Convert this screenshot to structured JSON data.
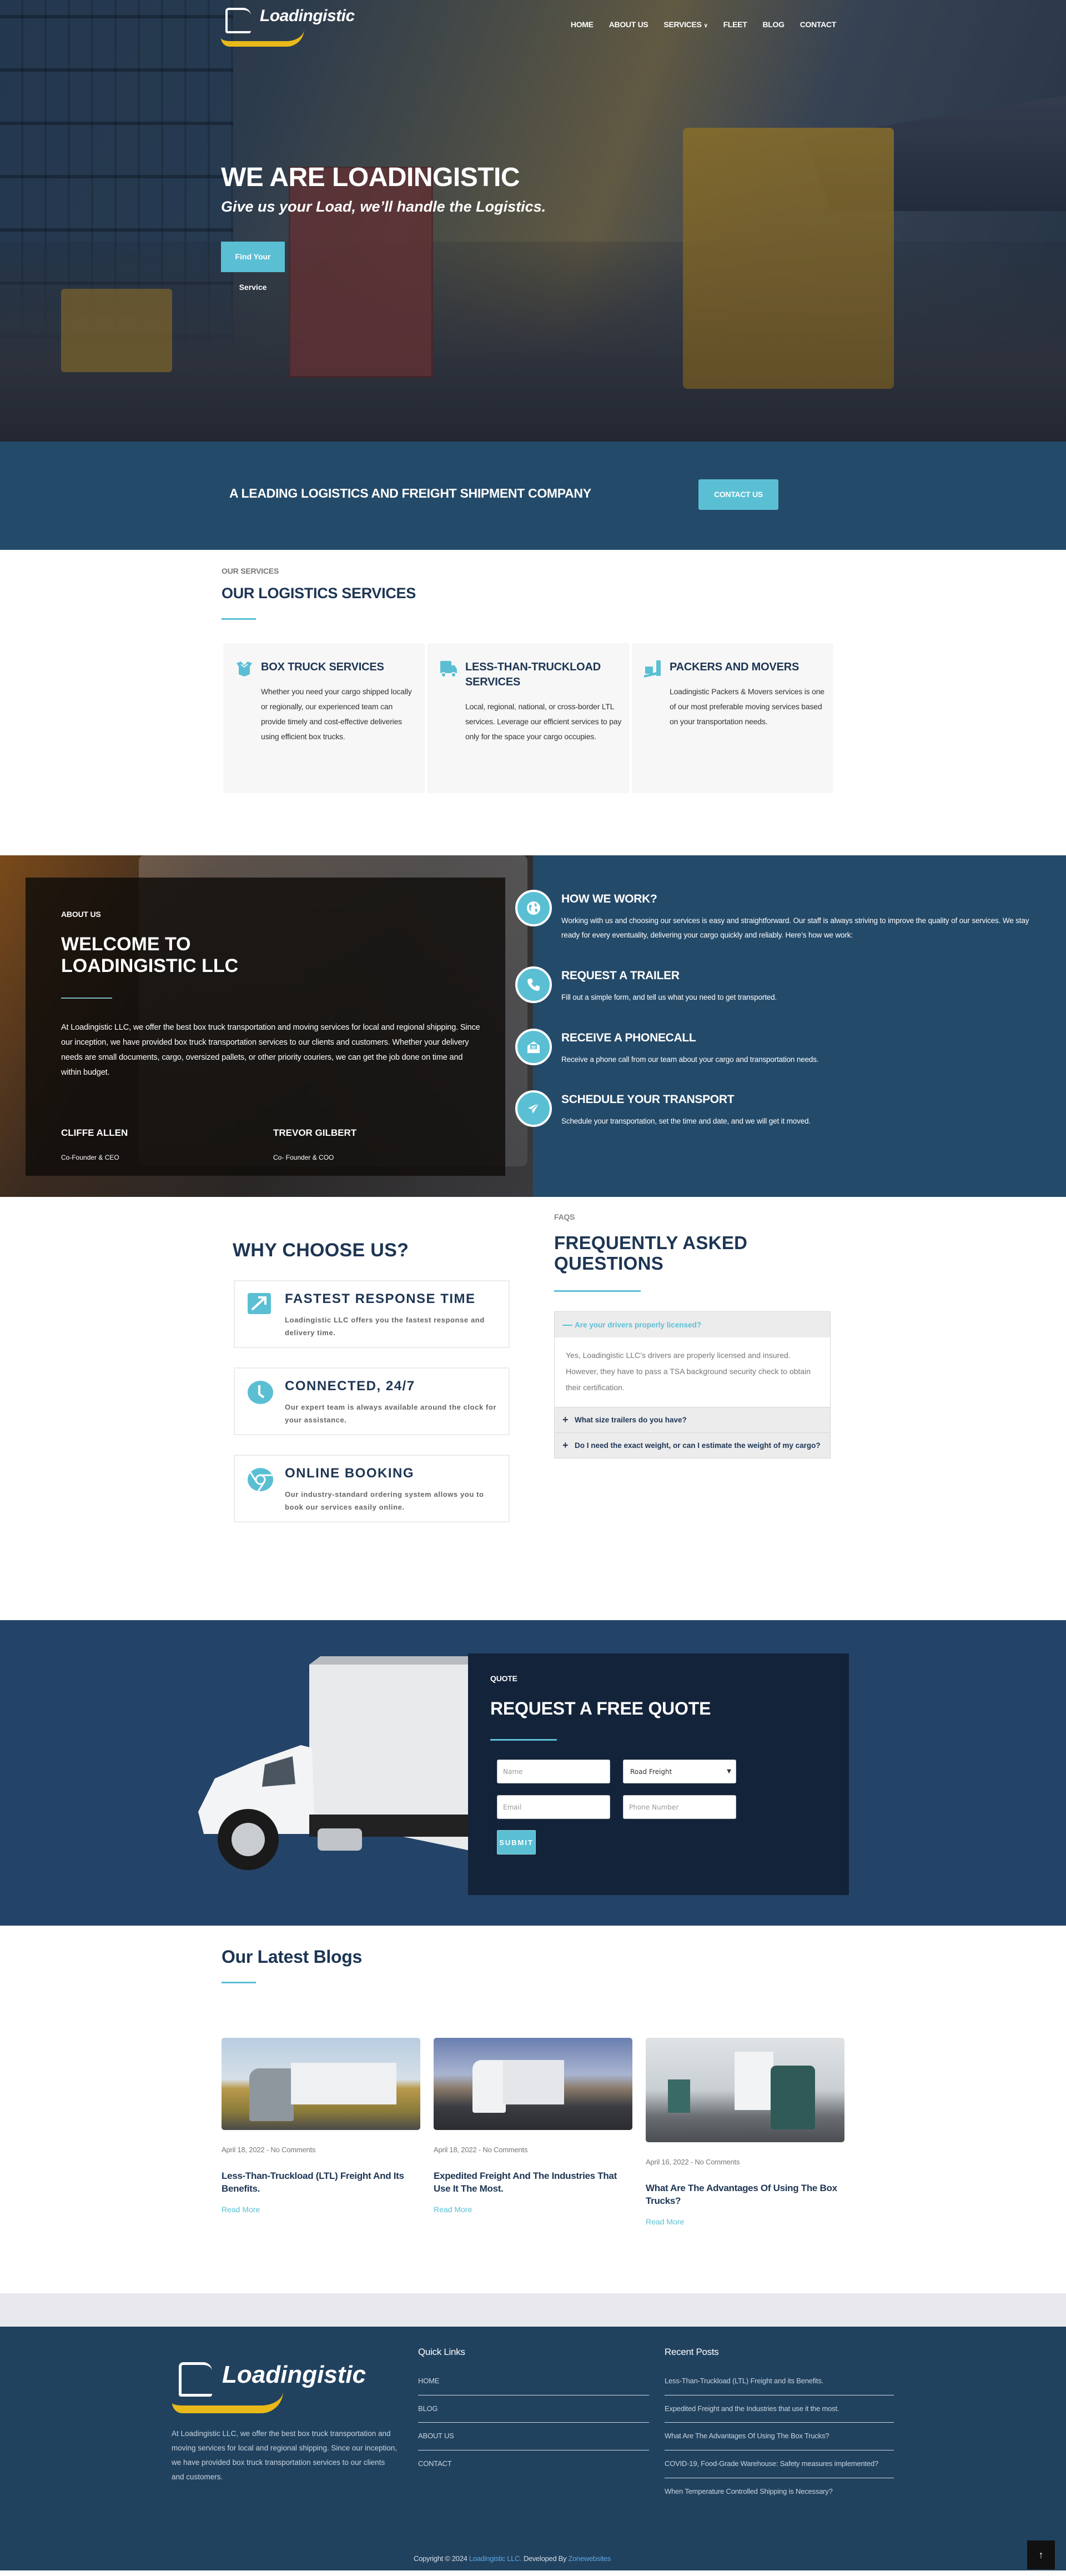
{
  "brand": {
    "name": "Loadingistic",
    "accent": "#5bbfd4",
    "navy": "#1d3553",
    "band": "#244a69",
    "logo_yellow": "#e9b91a"
  },
  "nav": {
    "items": [
      {
        "label": "HOME"
      },
      {
        "label": "ABOUT US"
      },
      {
        "label": "SERVICES",
        "has_dropdown": true
      },
      {
        "label": "FLEET"
      },
      {
        "label": "BLOG"
      },
      {
        "label": "CONTACT"
      }
    ]
  },
  "hero": {
    "title": "WE ARE LOADINGISTIC",
    "tagline": "Give us your Load, we’ll handle the Logistics.",
    "cta_label": "Find Your Service"
  },
  "cta_band": {
    "text": "A LEADING LOGISTICS AND FREIGHT SHIPMENT COMPANY",
    "button_label": "CONTACT US"
  },
  "services": {
    "eyebrow": "OUR SERVICES",
    "title": "OUR LOGISTICS SERVICES",
    "items": [
      {
        "icon": "open-box-icon",
        "title": "BOX TRUCK SERVICES",
        "text": "Whether you need your cargo shipped locally or regionally, our experienced team can provide timely and cost-effective deliveries using efficient box trucks."
      },
      {
        "icon": "truck-icon",
        "title": "LESS-THAN-TRUCKLOAD SERVICES",
        "text": "Local, regional, national, or cross-border LTL services. Leverage our efficient services to pay only for the space your cargo occupies."
      },
      {
        "icon": "dolly-box-icon",
        "title": "PACKERS AND MOVERS",
        "text": "Loadingistic Packers & Movers services is one of our most preferable moving services based on your transportation needs."
      }
    ]
  },
  "about": {
    "eyebrow": "ABOUT US",
    "title": "WELCOME TO LOADINGISTIC LLC",
    "text": "At Loadingistic LLC, we offer the best box truck transportation and moving services for local and regional shipping. Since our inception, we have provided box truck transportation services to our clients and customers. Whether your delivery needs are small documents, cargo, oversized pallets, or other priority couriers, we can get the job done on time and within budget.",
    "founders": [
      {
        "name": "CLIFFE ALLEN",
        "role": "Co-Founder & CEO"
      },
      {
        "name": "TREVOR GILBERT",
        "role": "Co- Founder & COO"
      }
    ]
  },
  "how": {
    "steps": [
      {
        "icon": "globe-icon",
        "title": "HOW WE WORK?",
        "text": "Working with us and choosing our services is easy and straightforward. Our staff is always striving to improve the quality of our services. We stay ready for every eventuality, delivering your cargo quickly and reliably. Here’s how we work:"
      },
      {
        "icon": "phone-icon",
        "title": "REQUEST A TRAILER",
        "text": "Fill out a simple form, and tell us what you need to get transported."
      },
      {
        "icon": "envelope-open-icon",
        "title": "RECEIVE A PHONECALL",
        "text": "Receive a phone call from our team about your cargo and transportation needs."
      },
      {
        "icon": "paper-plane-icon",
        "title": "SCHEDULE YOUR TRANSPORT",
        "text": "Schedule your transportation, set the time and date, and we will get it moved."
      }
    ]
  },
  "why": {
    "title": "WHY CHOOSE US?",
    "items": [
      {
        "icon": "arrow-up-right-icon",
        "title": "FASTEST RESPONSE TIME",
        "text": "Loadingistic LLC offers you the fastest response and delivery time."
      },
      {
        "icon": "clock-icon",
        "title": "CONNECTED, 24/7",
        "text": "Our expert team is always available around the clock for your assistance."
      },
      {
        "icon": "chrome-icon",
        "title": "ONLINE BOOKING",
        "text": "Our industry-standard ordering system allows you to book our services easily online."
      }
    ]
  },
  "faq": {
    "eyebrow": "FAQS",
    "title": "FREQUENTLY ASKED QUESTIONS",
    "items": [
      {
        "q": "Are your drivers properly licensed?",
        "open": true,
        "a": "Yes, Loadingistic LLC’s drivers are properly licensed and insured. However, they have to pass a TSA background security check to obtain their certification."
      },
      {
        "q": "What size trailers do you have?",
        "open": false
      },
      {
        "q": "Do I need the exact weight, or can I estimate the weight of my cargo?",
        "open": false
      }
    ]
  },
  "quote": {
    "eyebrow": "QUOTE",
    "title": "REQUEST A FREE QUOTE",
    "fields": {
      "name_placeholder": "Name",
      "service_selected": "Road Freight",
      "email_placeholder": "Email",
      "phone_placeholder": "Phone Number"
    },
    "submit_label": "SUBMIT"
  },
  "blogs": {
    "title": "Our Latest Blogs",
    "posts": [
      {
        "date": "April 18, 2022",
        "comments": "No Comments",
        "title": "Less-Than-Truckload (LTL) Freight And Its Benefits.",
        "read_more": "Read More"
      },
      {
        "date": "April 18, 2022",
        "comments": "No Comments",
        "title": "Expedited Freight And The Industries That Use It The Most.",
        "read_more": "Read More"
      },
      {
        "date": "April 16, 2022",
        "comments": "No Comments",
        "title": "What Are The Advantages Of Using The Box Trucks?",
        "read_more": "Read More"
      }
    ]
  },
  "footer": {
    "about": "At Loadingistic LLC, we offer the best box truck transportation and moving services for local and regional shipping. Since our inception, we have provided box truck transportation services to our clients and customers.",
    "quick_links_title": "Quick Links",
    "quick_links": [
      "HOME",
      "BLOG",
      "ABOUT US",
      "CONTACT"
    ],
    "recent_posts_title": "Recent Posts",
    "recent_posts": [
      "Less-Than-Truckload (LTL) Freight and its Benefits.",
      "Expedited Freight and the Industries that use it the most.",
      "What Are The Advantages Of Using The Box Trucks?",
      "COVID-19, Food-Grade Warehouse: Safety measures implemented?",
      "When Temperature Controlled Shipping is Necessary?"
    ],
    "copyright_prefix": "Copyright © 2024 ",
    "copyright_company": "Loadingistic LLC.",
    "developed_by_prefix": " Developed By ",
    "developer": "Zonewebsites",
    "back_to_top": "↑"
  }
}
